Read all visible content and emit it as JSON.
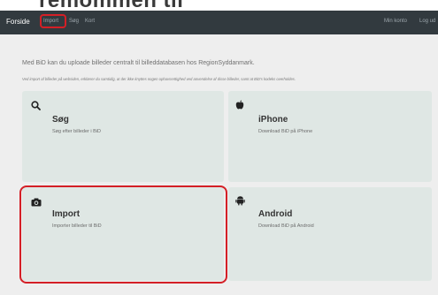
{
  "header_fragment": "remommen til",
  "navbar": {
    "brand": "Forside",
    "links": [
      "Import",
      "Søg",
      "Kort"
    ],
    "right_links": [
      "Min konto",
      "Log ud"
    ]
  },
  "intro": "Med BiD kan du uploade billeder centralt til billeddatabasen hos RegionSyddanmark.",
  "note": "Ved import af billeder på websiden, erklærer du samtidig, at der ikke knyttes nogen ophavsrettighed ved anvendelse af disse billeder, samt at BiD's kodeks overholdes.",
  "cards": [
    {
      "title": "Søg",
      "desc": "Søg efter billeder i BiD",
      "icon": "search-icon"
    },
    {
      "title": "iPhone",
      "desc": "Download BiD på iPhone",
      "icon": "apple-icon"
    },
    {
      "title": "Import",
      "desc": "Importer billeder til BiD",
      "icon": "camera-icon"
    },
    {
      "title": "Android",
      "desc": "Download BiD på Android",
      "icon": "android-icon"
    }
  ],
  "colors": {
    "navbar": "#323a3f",
    "card": "#dfe7e4",
    "highlight": "#d41f26",
    "page_bg": "#eeeeee"
  }
}
